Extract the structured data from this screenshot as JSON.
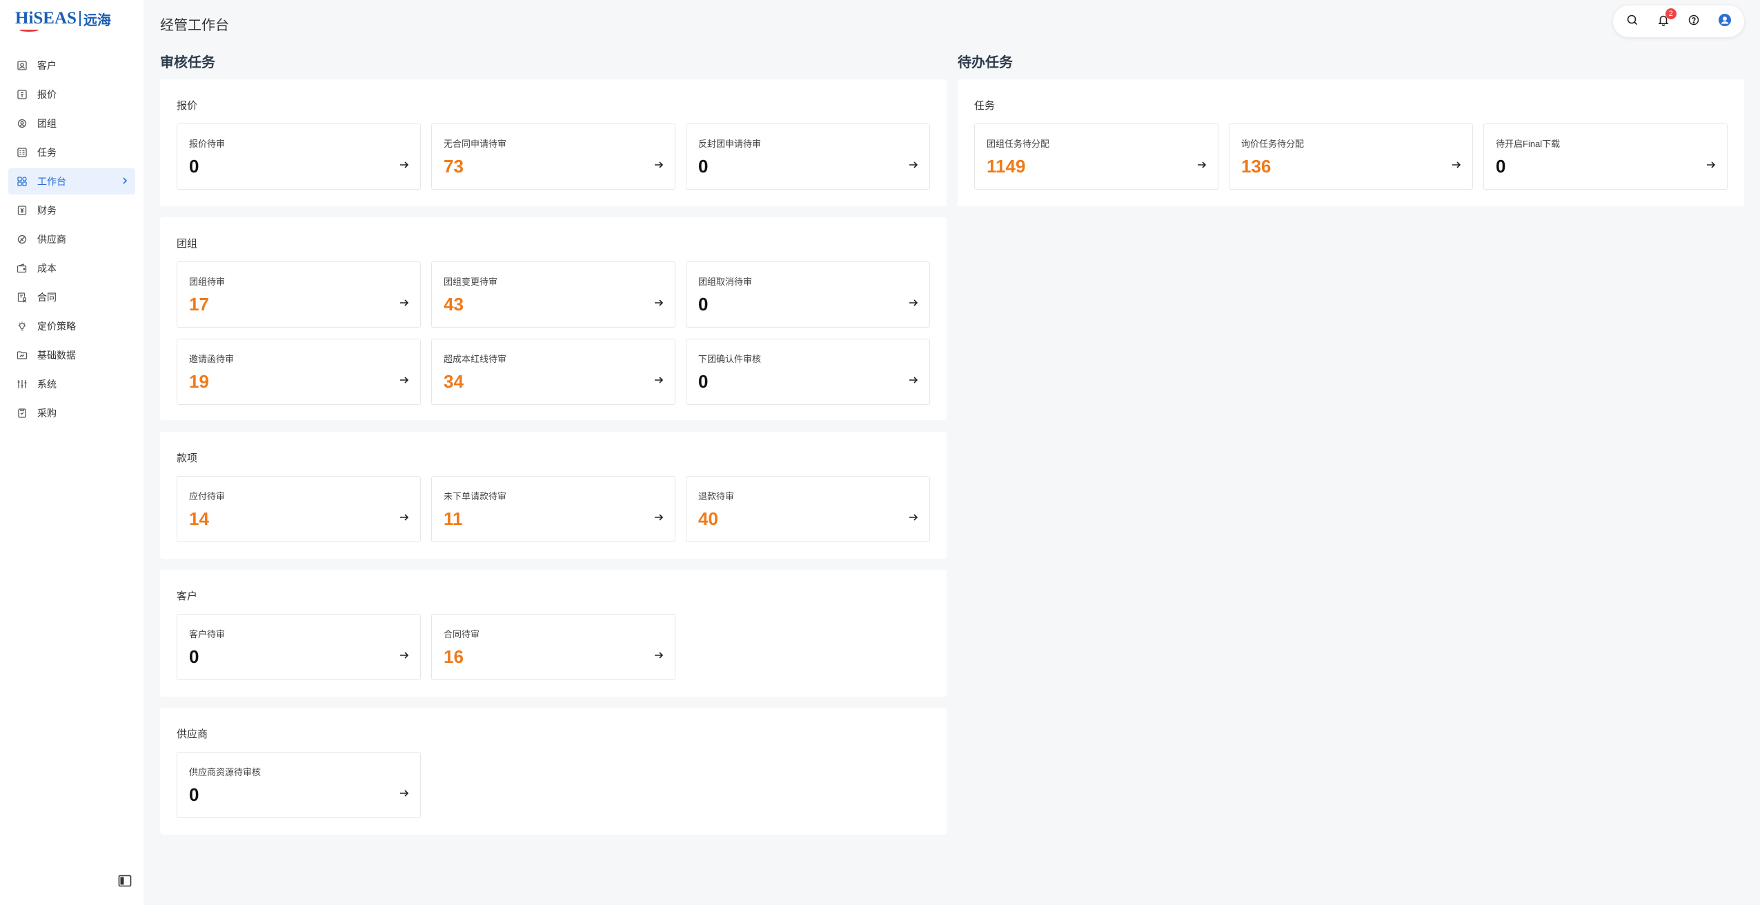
{
  "sidebar": {
    "logo_text": "HiSEAS",
    "logo_cn": "远海",
    "items": [
      {
        "label": "客户",
        "icon": "customer-icon"
      },
      {
        "label": "报价",
        "icon": "quote-icon"
      },
      {
        "label": "团组",
        "icon": "group-icon"
      },
      {
        "label": "任务",
        "icon": "task-icon"
      },
      {
        "label": "工作台",
        "icon": "workbench-icon"
      },
      {
        "label": "财务",
        "icon": "finance-icon"
      },
      {
        "label": "供应商",
        "icon": "supplier-icon"
      },
      {
        "label": "成本",
        "icon": "wallet-icon"
      },
      {
        "label": "合同",
        "icon": "contract-icon"
      },
      {
        "label": "定价策略",
        "icon": "bulb-icon"
      },
      {
        "label": "基础数据",
        "icon": "folder-icon"
      },
      {
        "label": "系统",
        "icon": "sliders-icon"
      },
      {
        "label": "采购",
        "icon": "purchase-icon"
      }
    ],
    "active_index": 4
  },
  "header": {
    "title": "经管工作台",
    "notification_count": "2"
  },
  "review": {
    "title": "审核任务",
    "groups": {
      "quote": {
        "title": "报价",
        "cards": [
          {
            "label": "报价待审",
            "value": "0"
          },
          {
            "label": "无合同申请待审",
            "value": "73"
          },
          {
            "label": "反封团申请待审",
            "value": "0"
          }
        ]
      },
      "group": {
        "title": "团组",
        "cards": [
          {
            "label": "团组待审",
            "value": "17"
          },
          {
            "label": "团组变更待审",
            "value": "43"
          },
          {
            "label": "团组取消待审",
            "value": "0"
          },
          {
            "label": "邀请函待审",
            "value": "19"
          },
          {
            "label": "超成本红线待审",
            "value": "34"
          },
          {
            "label": "下团确认件审核",
            "value": "0"
          }
        ]
      },
      "payment": {
        "title": "款项",
        "cards": [
          {
            "label": "应付待审",
            "value": "14"
          },
          {
            "label": "未下单请款待审",
            "value": "11"
          },
          {
            "label": "退款待审",
            "value": "40"
          }
        ]
      },
      "customer": {
        "title": "客户",
        "cards": [
          {
            "label": "客户待审",
            "value": "0"
          },
          {
            "label": "合同待审",
            "value": "16"
          }
        ]
      },
      "supplier": {
        "title": "供应商",
        "cards": [
          {
            "label": "供应商资源待审核",
            "value": "0"
          }
        ]
      }
    }
  },
  "todo": {
    "title": "待办任务",
    "groups": {
      "task": {
        "title": "任务",
        "cards": [
          {
            "label": "团组任务待分配",
            "value": "1149"
          },
          {
            "label": "询价任务待分配",
            "value": "136"
          },
          {
            "label": "待开启Final下载",
            "value": "0"
          }
        ]
      }
    }
  },
  "colors": {
    "accent": "#2b6fd6",
    "highlight_value": "#f07a18",
    "badge": "#f04444"
  }
}
